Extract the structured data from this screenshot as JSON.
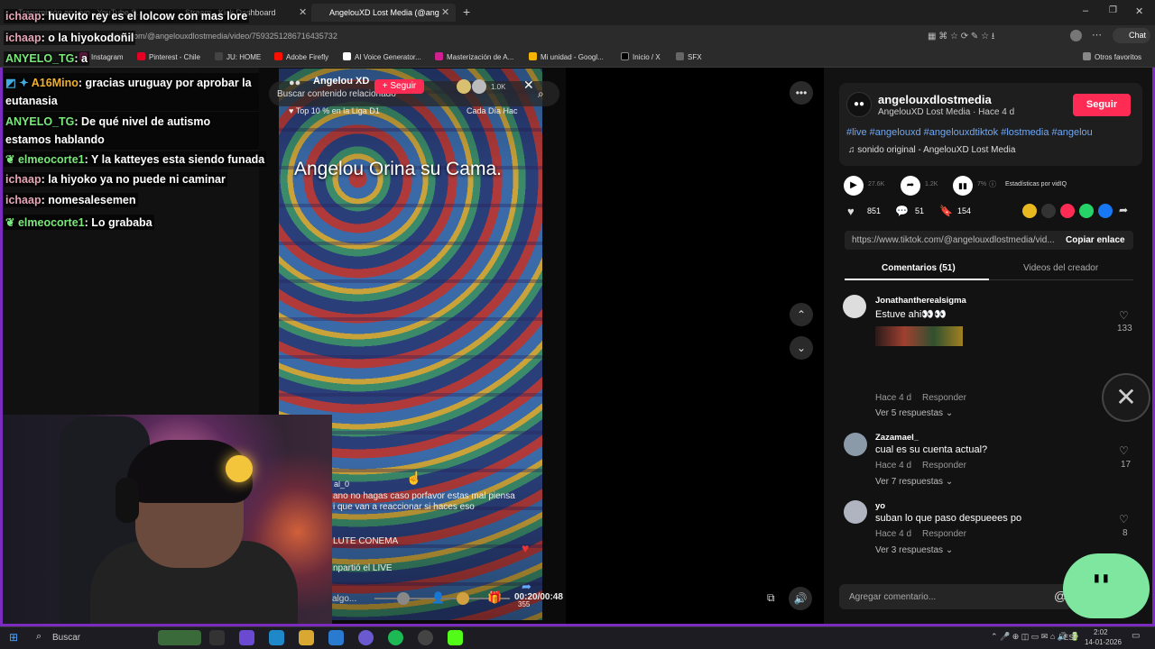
{
  "browser": {
    "tabs": [
      "Transmisión en vivo - YouTube S...",
      "Stream - Kick Dashboard",
      "AngelouXD Lost Media (@ang"
    ],
    "url": "tiktok.com/@angelouxdlostmedia/video/7593251286716435732",
    "chat_label": "Chat",
    "bookmarks": [
      "Instagram",
      "Pinterest - Chile",
      "JU: HOME",
      "Adobe Firefly",
      "AI Voice Generator...",
      "Masterización de A...",
      "Mi unidad - Googl...",
      "Inicio / X",
      "SFX"
    ],
    "other_bookmarks": "Otros favoritos"
  },
  "chat": [
    {
      "user": "ichaap",
      "msg": ": huevito rey es el lolcow con mas lore",
      "color": "#e8a7b8"
    },
    {
      "user": "ichaap",
      "msg": ": o la hiyokodoñil",
      "color": "#e8a7b8"
    },
    {
      "user": "ANYELO_TG",
      "msg": ": a",
      "color": "#7be87b"
    },
    {
      "user": "A16Mino",
      "msg": ": gracias uruguay por aprobar la eutanasia",
      "color": "#f0b030"
    },
    {
      "user": "ANYELO_TG",
      "msg": ": De qué nivel de autismo estamos hablando",
      "color": "#7be87b"
    },
    {
      "user": "elmeocorte1",
      "msg": ": Y la katteyes esta siendo funada",
      "color": "#7be87b"
    },
    {
      "user": "ichaap",
      "msg": ": la hiyoko ya no puede ni caminar",
      "color": "#e8a7b8"
    },
    {
      "user": "ichaap",
      "msg": ": nomesalesemen",
      "color": "#e8a7b8"
    },
    {
      "user": "elmeocorte1",
      "msg": ": Lo grababa",
      "color": "#7be87b"
    }
  ],
  "video": {
    "author": "Angelou XD",
    "follow": "+ Seguir",
    "search_placeholder": "Buscar contenido relacionado",
    "views_small": "1.0K",
    "league": "Top 10 % en la Liga D1",
    "daily": "Cada Día Hac",
    "caption": "Angelou Orina su Cama.",
    "live_user": "al_0",
    "live_msg1": "ano no hagas caso porfavor estas mal piensa",
    "live_msg2": "i que van a reaccionar si haces eso",
    "live_msg3": "LUTE CONEMA",
    "live_msg4": "npartió el LIVE",
    "input_hint": "algo...",
    "time": "00:20/00:48",
    "share_count": "355"
  },
  "panel": {
    "username": "angelouxdlostmedia",
    "subtitle": "AngelouXD Lost Media · Hace 4 d",
    "follow_btn": "Seguir",
    "hashtags": "#live #angelouxd #angelouxdtiktok #lostmedia #angelou",
    "sound": "sonido original - AngelouXD Lost Media",
    "plays": "27.6K",
    "shares_small": "1.2K",
    "pct": "7%",
    "stats_label": "Estadísticas por vidIQ",
    "likes": "851",
    "comments_count": "51",
    "saves": "154",
    "link": "https://www.tiktok.com/@angelouxdlostmedia/vid...",
    "copy_link": "Copiar enlace",
    "tab_comments": "Comentarios (51)",
    "tab_creator": "Videos del creador",
    "comments": [
      {
        "user": "Jonathantherealsigma",
        "text": "Estuve ahi👀👀",
        "meta": "Hace 4 d",
        "reply": "Responder",
        "more": "Ver 5 respuestas",
        "likes": "133"
      },
      {
        "user": "Zazamael_",
        "text": "cual es su cuenta actual?",
        "meta": "Hace 4 d",
        "reply": "Responder",
        "more": "Ver 7 respuestas",
        "likes": "17"
      },
      {
        "user": "yo",
        "text": "suban lo que paso despueees po",
        "meta": "Hace 4 d",
        "reply": "Responder",
        "more": "Ver 3 respuestas",
        "likes": "8"
      }
    ],
    "add_comment": "Agregar comentario..."
  },
  "taskbar": {
    "search": "Buscar",
    "lang": "ESP",
    "time": "2:02",
    "date": "14-01-2026"
  }
}
